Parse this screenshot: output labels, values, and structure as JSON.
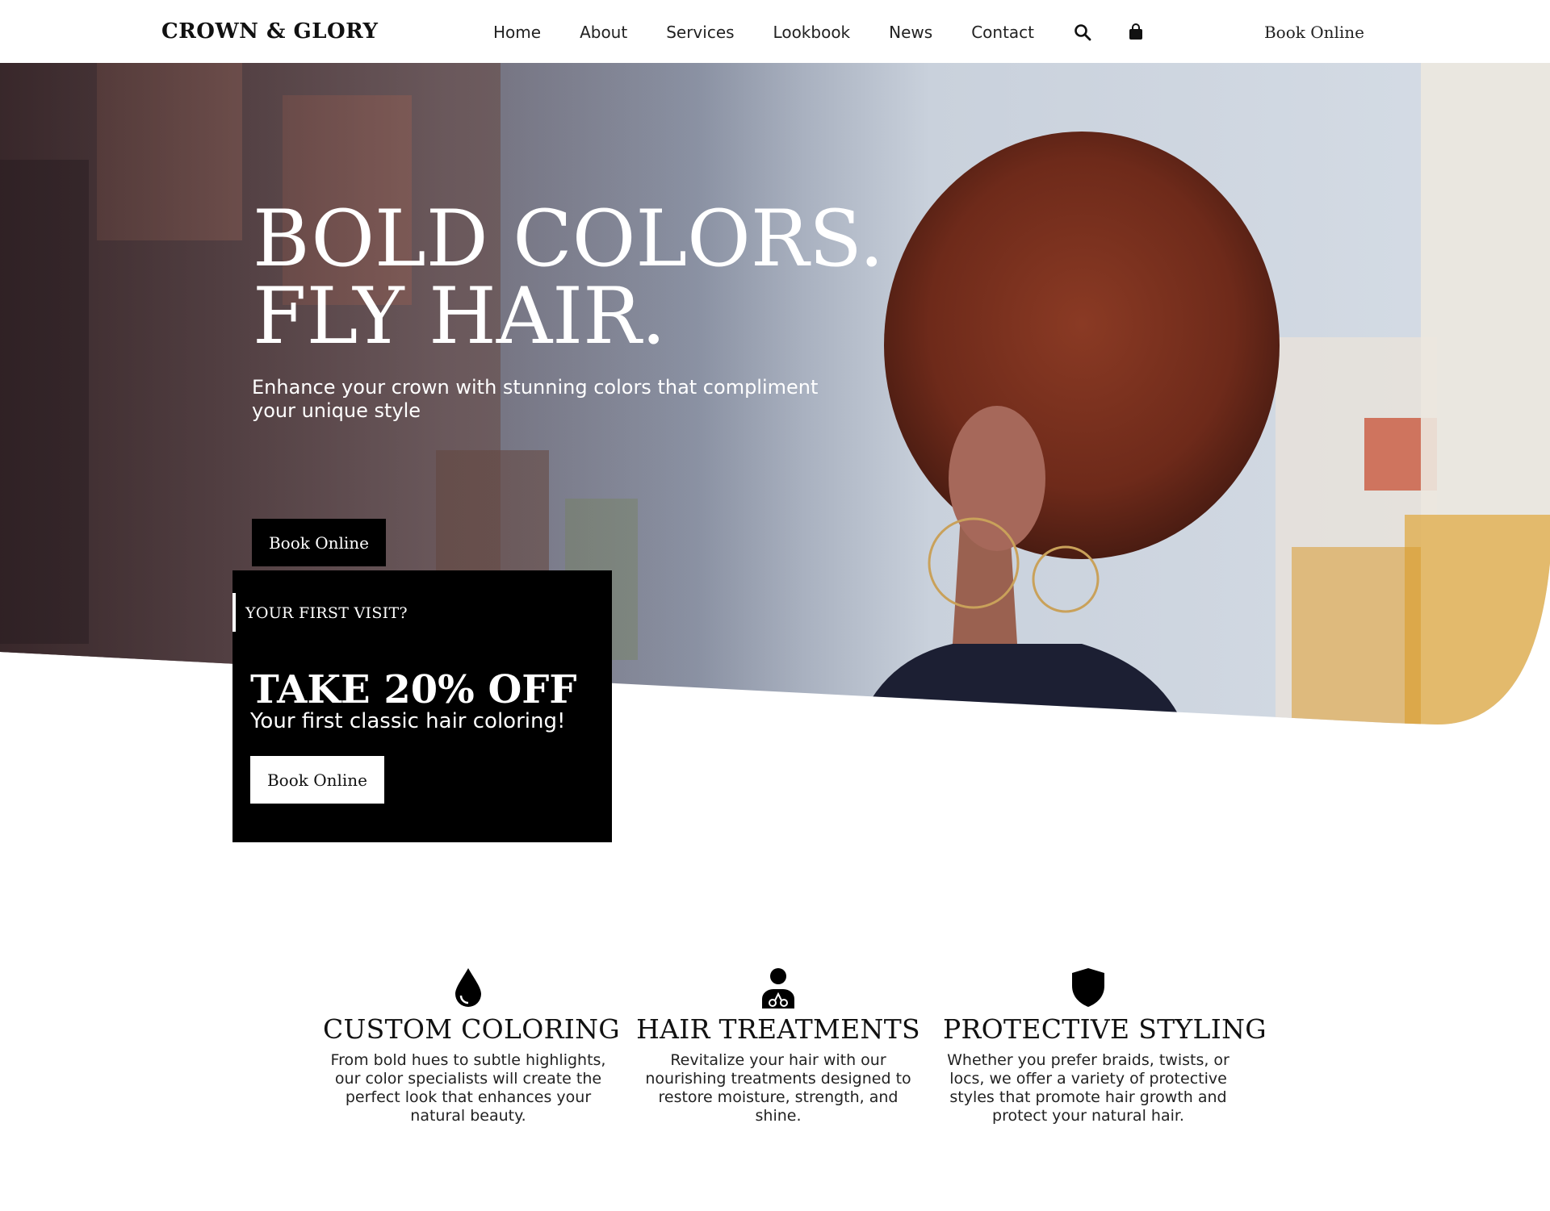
{
  "brand": {
    "logo": "CROWN & GLORY"
  },
  "nav": {
    "items": [
      "Home",
      "About",
      "Services",
      "Lookbook",
      "News",
      "Contact"
    ],
    "search_icon": "search-icon",
    "cart_icon": "shopping-bag-icon",
    "book_label": "Book Online"
  },
  "hero": {
    "title_line1": "BOLD COLORS.",
    "title_line2": "FLY HAIR.",
    "subtitle": "Enhance your crown with stunning colors that compliment your unique style",
    "button_label": "Book Online"
  },
  "promo": {
    "eyebrow": "YOUR FIRST VISIT?",
    "title": "TAKE 20% OFF",
    "subtitle": "Your first classic hair coloring!",
    "button_label": "Book Online"
  },
  "features": [
    {
      "icon": "droplet-icon",
      "title": "CUSTOM COLORING",
      "text": "From bold hues to subtle highlights, our color specialists will create the perfect look that enhances your natural beauty."
    },
    {
      "icon": "stylist-icon",
      "title": "HAIR TREATMENTS",
      "text": "Revitalize your hair with our nourishing treatments designed to restore moisture, strength, and shine."
    },
    {
      "icon": "shield-icon",
      "title": "PROTECTIVE STYLING",
      "text": "Whether you prefer braids, twists, or locs, we offer a variety of protective styles that promote hair growth and protect your natural hair."
    }
  ],
  "colors": {
    "accent": "#000000",
    "background": "#ffffff",
    "hair": "#7a2f1e"
  }
}
